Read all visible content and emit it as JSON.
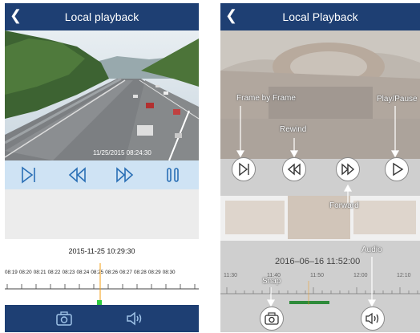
{
  "left": {
    "title": "Local playback",
    "back_icon": "chevron-left-icon",
    "timestamp_overlay": "11/25/2015  08:24:30",
    "controls": [
      "step-forward-icon",
      "rewind-icon",
      "fast-forward-icon",
      "pause-icon"
    ],
    "datetime": "2015-11-25 10:29:30",
    "timeline_labels": [
      "08:19",
      "08:20",
      "08:21",
      "08:22",
      "08:23",
      "08:24",
      "08:25",
      "08:26",
      "08:27",
      "08:28",
      "08:29",
      "08:30"
    ],
    "bottom_icons": [
      "camera-icon",
      "speaker-icon"
    ],
    "colors": {
      "header": "#1e3f73",
      "controls_bg": "#cfe3f4",
      "accent": "#2a6fb5",
      "marker": "#2ecc40",
      "cursor": "#f39c12"
    }
  },
  "right": {
    "title": "Local Playback",
    "back_icon": "chevron-left-icon",
    "annotations": {
      "frame": "Frame by Frame",
      "rewind": "Rewind",
      "play": "Play/Pause",
      "forward": "Forward",
      "audio": "Audio",
      "snap": "Snap"
    },
    "datetime": "2016–06–16  11:52:00",
    "timeline_labels": [
      "11:30",
      "11:40",
      "11:50",
      "12:00",
      "12:10"
    ]
  }
}
